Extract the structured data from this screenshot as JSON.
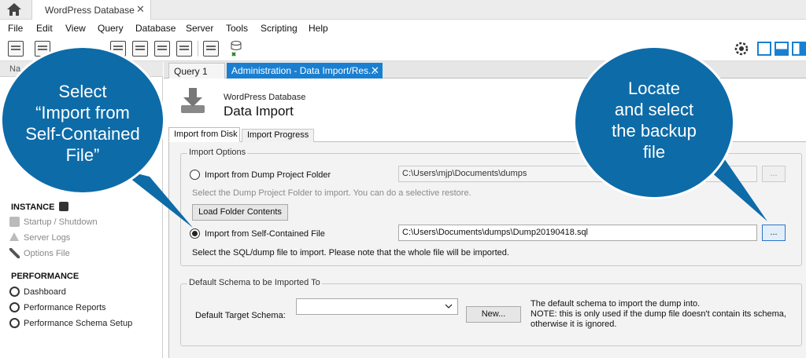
{
  "connection_tab": {
    "title": "WordPress Database",
    "close": "✕"
  },
  "menu": [
    "File",
    "Edit",
    "View",
    "Query",
    "Database",
    "Server",
    "Tools",
    "Scripting",
    "Help"
  ],
  "sidebar": {
    "header": "Na",
    "instance_heading": "INSTANCE",
    "instance_items": [
      "Startup / Shutdown",
      "Server Logs",
      "Options File"
    ],
    "performance_heading": "PERFORMANCE",
    "performance_items": [
      "Dashboard",
      "Performance Reports",
      "Performance Schema Setup"
    ]
  },
  "doc_tabs": {
    "query": "Query 1",
    "admin": "Administration - Data Import/Res...",
    "close": "✕"
  },
  "heading": {
    "subtitle": "WordPress Database",
    "title": "Data Import"
  },
  "subtabs": [
    "Import from Disk",
    "Import Progress"
  ],
  "import_options": {
    "title": "Import Options",
    "dump_folder_label": "Import from Dump Project Folder",
    "dump_folder_path": "C:\\Users\\mjp\\Documents\\dumps",
    "dump_folder_browse": "...",
    "dump_folder_hint": "Select the Dump Project Folder to import. You can do a selective restore.",
    "load_button": "Load Folder Contents",
    "self_contained_label": "Import from Self-Contained File",
    "self_contained_path": "C:\\Users\\Documents\\dumps\\Dump20190418.sql",
    "self_contained_browse": "...",
    "self_contained_hint": "Select the SQL/dump file to import. Please note that the whole file will be imported.",
    "selected_option": "self_contained"
  },
  "default_schema": {
    "title": "Default Schema to be Imported To",
    "label": "Default Target Schema:",
    "value": "",
    "new_button": "New...",
    "note_1": "The default schema to import the dump into.",
    "note_2": "NOTE: this is only used if the dump file doesn't contain its schema,",
    "note_3": "otherwise it is ignored."
  },
  "callouts": {
    "left": [
      "Select",
      "“Import from",
      "Self-Contained",
      "File”"
    ],
    "right": [
      "Locate",
      "and select",
      "the backup",
      "file"
    ]
  },
  "colors": {
    "callout": "#0d6ba8",
    "tab_active": "#1a7fd0"
  }
}
